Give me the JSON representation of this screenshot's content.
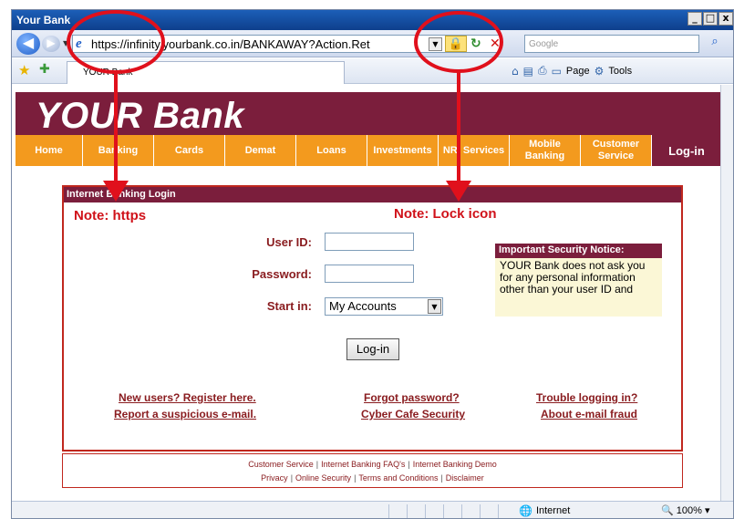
{
  "browser": {
    "window_title": "Your Bank",
    "window_buttons": [
      "_",
      "□",
      "x"
    ],
    "url": "https://infinity.yourbank.co.in/BANKAWAY?Action.Ret",
    "search_placeholder": "Google",
    "tab_title": "YOUR Bank",
    "toolbar": {
      "page_label": "Page",
      "tools_label": "Tools"
    },
    "status": {
      "zone": "Internet",
      "zoom": "100%"
    }
  },
  "site": {
    "logo": "YOUR Bank",
    "menu": [
      "Home",
      "Banking",
      "Cards",
      "Demat",
      "Loans",
      "Investments",
      "NRI Services",
      "Mobile Banking",
      "Customer Service",
      "Log-in"
    ]
  },
  "panel": {
    "title": "Internet Banking Login",
    "user_id_label": "User ID:",
    "password_label": "Password:",
    "start_in_label": "Start in:",
    "start_in_value": "My Accounts",
    "login_button": "Log-in",
    "notice_title": "Important Security Notice:",
    "notice_text": "YOUR Bank does not ask you for any personal information other than your user ID and",
    "links": {
      "register": "New users? Register here.",
      "report": "Report a suspicious e-mail.",
      "forgot": "Forgot password?",
      "cyber": "Cyber Cafe Security",
      "trouble": "Trouble logging in?",
      "fraud": "About e-mail fraud"
    }
  },
  "footer": {
    "row1": [
      "Customer Service",
      "Internet Banking FAQ's",
      "Internet Banking Demo"
    ],
    "row2": [
      "Privacy",
      "Online Security",
      "Terms and Conditions",
      "Disclaimer"
    ],
    "separator": "|"
  },
  "annotations": {
    "note_https": "Note: https",
    "note_lock": "Note: Lock icon",
    "color": "#e0101c"
  }
}
